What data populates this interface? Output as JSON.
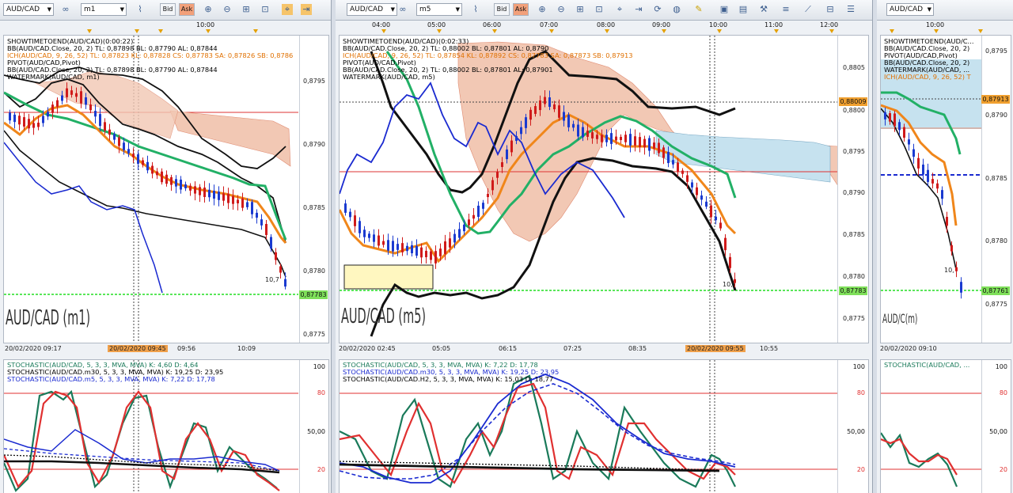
{
  "colors": {
    "accent_bid": "#f3f5f8",
    "accent_ask": "#f2a07a",
    "price_tag_green": "#7fe05a",
    "price_tag_orange": "#f0a030",
    "time_highlight": "#f0a04a"
  },
  "panels": [
    {
      "symbol": "AUD/CAD",
      "timeframe": "m1",
      "toolbar": {
        "bid": "Bid",
        "ask": "Ask"
      },
      "top_times": [
        "10:00"
      ],
      "legend": [
        {
          "text": "SHOWTIMETOEND(AUD/CAD)(0:00:22)",
          "color": "#000000"
        },
        {
          "text": "BB(AUD/CAD.Close, 20, 2)  TL: 0,87898  BL: 0,87790  AL: 0,87844",
          "color": "#000000"
        },
        {
          "text": "ICH(AUD/CAD, 9, 26, 52)  TL: 0,87823  KL: 0,87828  CS: 0,87783  SA: 0,87826  SB: 0,8786",
          "color": "#e07000"
        },
        {
          "text": "PIVOT(AUD/CAD,Pivot)",
          "color": "#000000"
        },
        {
          "text": "BB(AUD/CAD.Close, 20, 2)  TL: 0,87898  BL: 0,87790  AL: 0,87844",
          "color": "#000000"
        },
        {
          "text": "WATERMARK(AUD/CAD, m1)",
          "color": "#000000"
        }
      ],
      "price_labels": [
        "0,8795",
        "0,8790",
        "0,8785",
        "0,8780",
        "0,8775"
      ],
      "current_price": "0,87783",
      "watermark": "AUD/CAD (m1)",
      "bottom_times": [
        {
          "t": "20/02/2020 09:17",
          "hl": false
        },
        {
          "t": "20/02/2020 09:45",
          "hl": true
        },
        {
          "t": "09:56",
          "hl": false
        },
        {
          "t": "10:09",
          "hl": false
        }
      ],
      "candle_note": "10,7",
      "stoch_legend": [
        {
          "text": "STOCHASTIC(AUD/CAD, 5, 3, 3, MVA, MVA)  K: 4,60  D: 4,64",
          "color": "#1a7a5a"
        },
        {
          "text": "STOCHASTIC(AUD/CAD.m30, 5, 3, 3, MVA, MVA)  K: 19,25  D: 23,95",
          "color": "#000000"
        },
        {
          "text": "STOCHASTIC(AUD/CAD.m5, 5, 3, 3, MVA, MVA)  K: 7,22  D: 17,78",
          "color": "#1a2ad0"
        }
      ],
      "stoch_levels": [
        "100",
        "80",
        "50,00",
        "20"
      ]
    },
    {
      "symbol": "AUD/CAD",
      "timeframe": "m5",
      "toolbar": {
        "bid": "Bid",
        "ask": "Ask"
      },
      "top_times": [
        "04:00",
        "05:00",
        "06:00",
        "07:00",
        "08:00",
        "09:00",
        "10:00",
        "11:00",
        "12:00"
      ],
      "legend": [
        {
          "text": "SHOWTIMETOEND(AUD/CAD)(0:02:33)",
          "color": "#000000"
        },
        {
          "text": "BB(AUD/CAD.Close, 20, 2)  TL: 0,88002  BL: 0,87801  AL: 0,8790",
          "color": "#000000"
        },
        {
          "text": "ICH(AUD/CAD, 9, 26, 52)  TL: 0,87854  KL: 0,87892  CS: 0,87783  SA: 0,87873  SB: 0,87913",
          "color": "#e07000"
        },
        {
          "text": "PIVOT(AUD/CAD,Pivot)",
          "color": "#000000"
        },
        {
          "text": "BB(AUD/CAD.Close, 20, 2)  TL: 0,88002  BL: 0,87801  AL: 0,87901",
          "color": "#000000"
        },
        {
          "text": "WATERMARK(AUD/CAD, m5)",
          "color": "#000000"
        }
      ],
      "price_labels": [
        "0,8805",
        "0,8800",
        "0,8795",
        "0,8790",
        "0,8785",
        "0,8780",
        "0,8775"
      ],
      "tag_upper": "0,88009",
      "current_price": "0,87783",
      "watermark": "AUD/CAD (m5)",
      "bottom_times": [
        {
          "t": "20/02/2020 02:45",
          "hl": false
        },
        {
          "t": "05:05",
          "hl": false
        },
        {
          "t": "06:15",
          "hl": false
        },
        {
          "t": "07:25",
          "hl": false
        },
        {
          "t": "08:35",
          "hl": false
        },
        {
          "t": "20/02/2020 09:55",
          "hl": true
        },
        {
          "t": "10:55",
          "hl": false
        }
      ],
      "candle_note": "10,",
      "stoch_legend": [
        {
          "text": "STOCHASTIC(AUD/CAD, 5, 3, 3, MVA, MVA)  K: 7,22  D: 17,78",
          "color": "#1a7a5a"
        },
        {
          "text": "STOCHASTIC(AUD/CAD.m30, 5, 3, 3, MVA, MVA)  K: 19,25  D: 23,95",
          "color": "#1a2ad0"
        },
        {
          "text": "STOCHASTIC(AUD/CAD.H2, 5, 3, 3, MVA, MVA)  K: 15,03  D: 18,77",
          "color": "#000000"
        }
      ],
      "stoch_levels": [
        "100",
        "80",
        "50,00",
        "20"
      ]
    },
    {
      "symbol": "AUD/CAD",
      "timeframe": "",
      "toolbar": {},
      "top_times": [
        "10:00"
      ],
      "legend": [
        {
          "text": "SHOWTIMETOEND(AUD/C...",
          "color": "#000000"
        },
        {
          "text": "BB(AUD/CAD.Close, 20, 2)",
          "color": "#000000"
        },
        {
          "text": "PIVOT(AUD/CAD,Pivot)",
          "color": "#000000"
        },
        {
          "text": "BB(AUD/CAD.Close, 20, 2)",
          "color": "#000000"
        },
        {
          "text": "WATERMARK(AUD/CAD, ...",
          "color": "#000000"
        },
        {
          "text": "ICH(AUD/CAD, 9, 26, 52)  T",
          "color": "#e07000"
        }
      ],
      "price_labels": [
        "0,8795",
        "0,8790",
        "0,8785",
        "0,8780",
        "0,8775"
      ],
      "tag_upper": "0,87913",
      "current_price": "0,87761",
      "watermark": "AUD/C(m)",
      "bottom_times": [
        {
          "t": "20/02/2020 09:10",
          "hl": false
        }
      ],
      "candle_note": "10,",
      "stoch_legend": [
        {
          "text": "STOCHASTIC(AUD/CAD, ...",
          "color": "#1a7a5a"
        }
      ],
      "stoch_levels": [
        "100",
        "80",
        "50,00",
        "20"
      ]
    }
  ]
}
